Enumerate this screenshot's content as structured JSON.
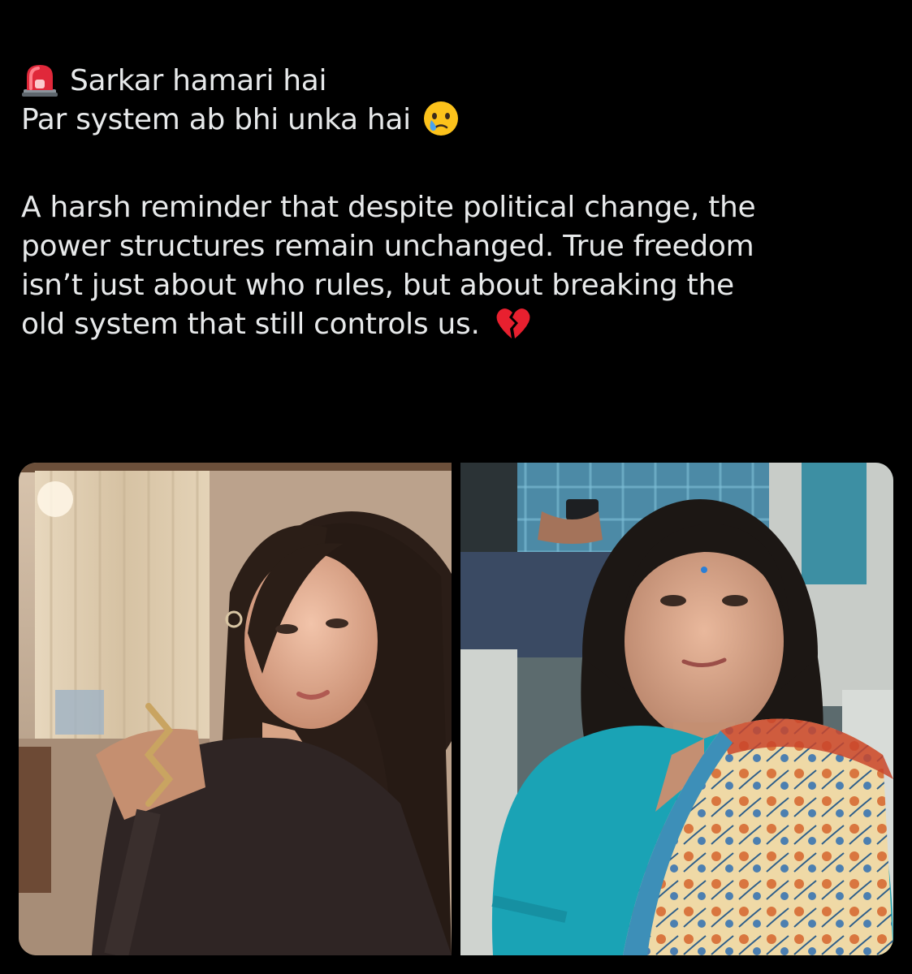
{
  "post": {
    "line1": "Sarkar hamari hai",
    "line2": "Par system ab bhi unka hai",
    "body_lines": [
      "A harsh reminder that despite political change, the",
      "power structures remain unchanged. True freedom",
      "isn’t just about who rules, but about breaking the",
      "old system that still controls us."
    ],
    "icons": {
      "line1": "police-light-emoji",
      "line2": "crying-face-emoji",
      "ending": "broken-heart-emoji"
    }
  },
  "media": {
    "count": 2,
    "images": [
      {
        "icon": "portrait-photo"
      },
      {
        "icon": "portrait-photo"
      }
    ]
  },
  "colors": {
    "background": "#000000",
    "text": "#e7e9ea"
  }
}
